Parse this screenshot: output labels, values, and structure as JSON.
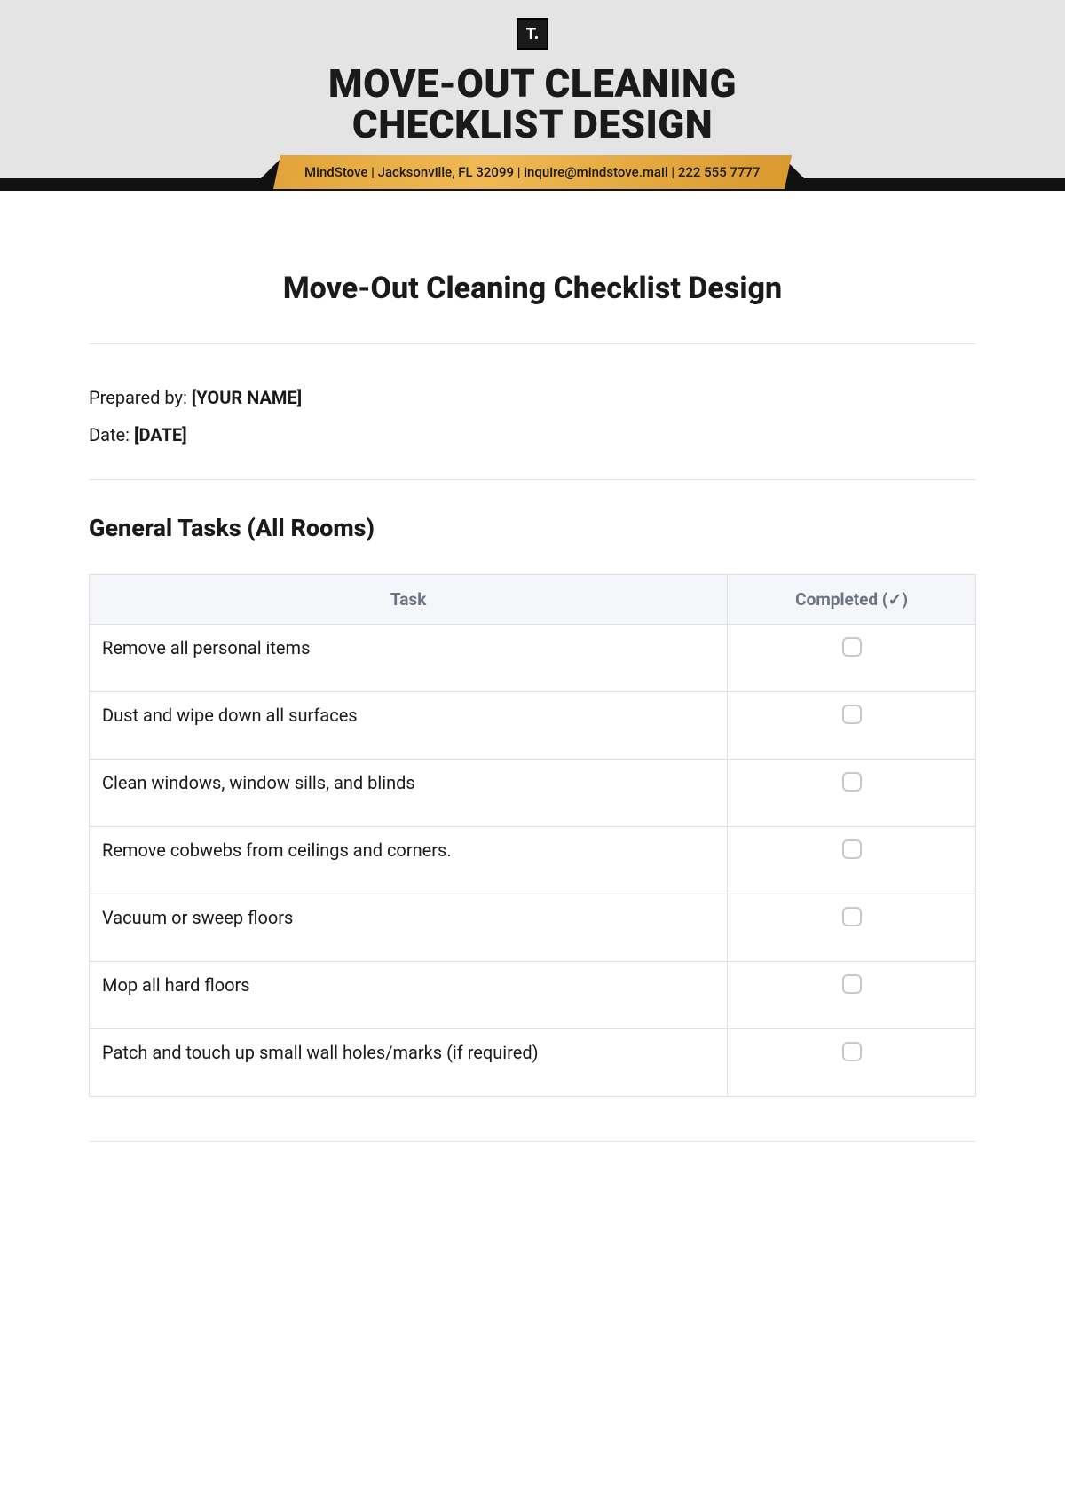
{
  "logo_text": "T.",
  "main_title_line1": "MOVE-OUT CLEANING",
  "main_title_line2": "CHECKLIST DESIGN",
  "ribbon_text": "MindStove | Jacksonville, FL 32099 | inquire@mindstove.mail | 222 555 7777",
  "section_title": "Move-Out Cleaning Checklist Design",
  "prepared_by_label": "Prepared by: ",
  "prepared_by_value": "[YOUR NAME]",
  "date_label": "Date: ",
  "date_value": "[DATE]",
  "subsection_title": "General Tasks (All Rooms)",
  "table": {
    "headers": {
      "task": "Task",
      "completed": "Completed (✓)"
    },
    "rows": [
      "Remove all personal items",
      "Dust and wipe down all surfaces",
      "Clean windows, window sills, and blinds",
      "Remove cobwebs from ceilings and corners.",
      "Vacuum or sweep floors",
      "Mop all hard floors",
      "Patch and touch up small wall holes/marks (if required)"
    ]
  }
}
